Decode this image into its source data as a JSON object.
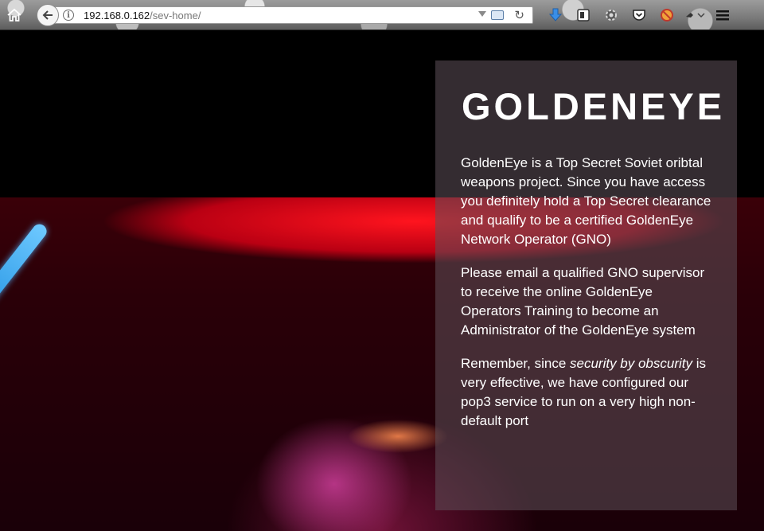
{
  "browser": {
    "url_host": "192.168.0.162",
    "url_path": "/sev-home/",
    "icons": [
      "home-icon",
      "back-arrow-icon",
      "info-icon",
      "dropdown-icon",
      "lan-icon",
      "reload-icon",
      "download-icon",
      "reader-icon",
      "gear-icon",
      "pocket-icon",
      "no-script-icon",
      "extension-icon",
      "menu-icon"
    ]
  },
  "page": {
    "title": "GOLDENEYE",
    "paragraph1": "GoldenEye is a Top Secret Soviet oribtal weapons project. Since you have access you definitely hold a Top Secret clearance and qualify to be a certified GoldenEye Network Operator (GNO)",
    "paragraph2": "Please email a qualified GNO supervisor to receive the online GoldenEye Operators Training to become an Administrator of the GoldenEye system",
    "paragraph3_start": "Remember, since ",
    "paragraph3_em": "security by obscurity",
    "paragraph3_end": " is very effective, we have configured our pop3 service to run on a very high non-default port"
  },
  "colors": {
    "accent_red": "#ff1420",
    "beam_blue": "#1e8fe0",
    "text": "#ffffff",
    "background": "#000000"
  }
}
